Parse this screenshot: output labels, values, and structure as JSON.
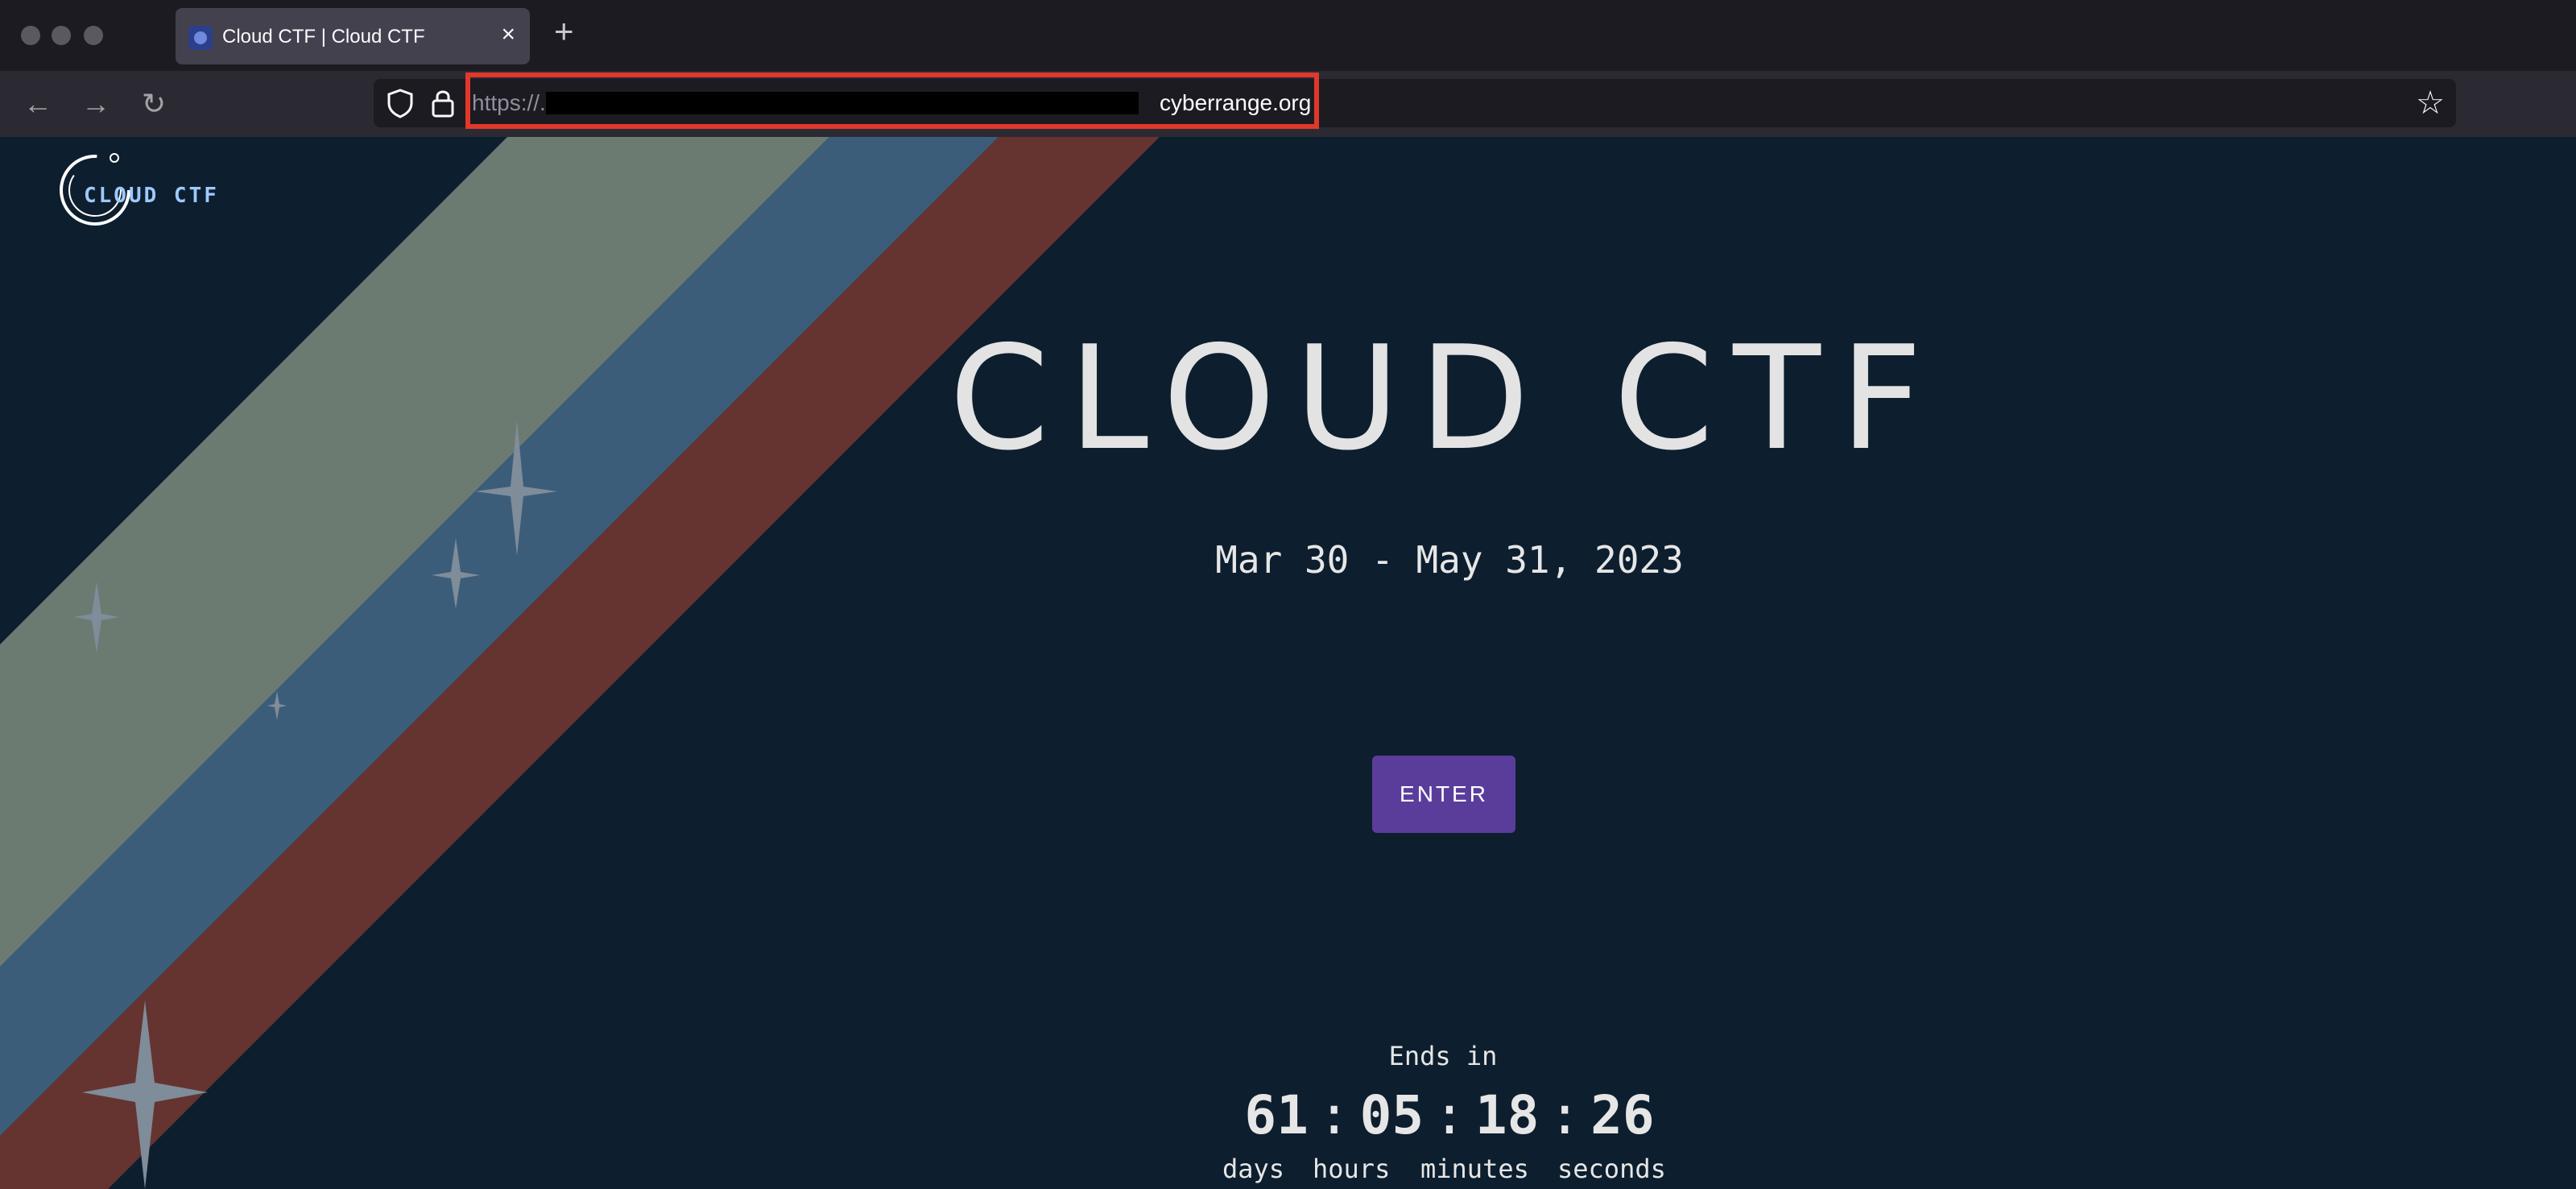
{
  "browser": {
    "tab": {
      "title": "Cloud CTF | Cloud CTF",
      "close_icon": "×"
    },
    "new_tab_icon": "+",
    "nav": {
      "back_icon": "←",
      "forward_icon": "→",
      "reload_icon": "↻"
    },
    "url": {
      "prefix": "https://.",
      "host": "cyberrange.org"
    },
    "bookmark_icon": "☆"
  },
  "page": {
    "logo_text": "CLOUD CTF",
    "title": "CLOUD CTF",
    "dates": "Mar 30 - May 31, 2023",
    "enter_label": "ENTER",
    "countdown": {
      "label": "Ends in",
      "days": "61",
      "hours": "05",
      "minutes": "18",
      "seconds": "26",
      "labels": {
        "days": "days",
        "hours": "hours",
        "minutes": "minutes",
        "seconds": "seconds"
      }
    }
  },
  "colors": {
    "background": "#0d1e2e",
    "stripe_sage": "#6b7b72",
    "stripe_blue": "#3b5d7a",
    "stripe_red": "#653431",
    "star": "#7f8c99",
    "button": "#5a3d9b",
    "url_highlight": "#e0382a"
  }
}
